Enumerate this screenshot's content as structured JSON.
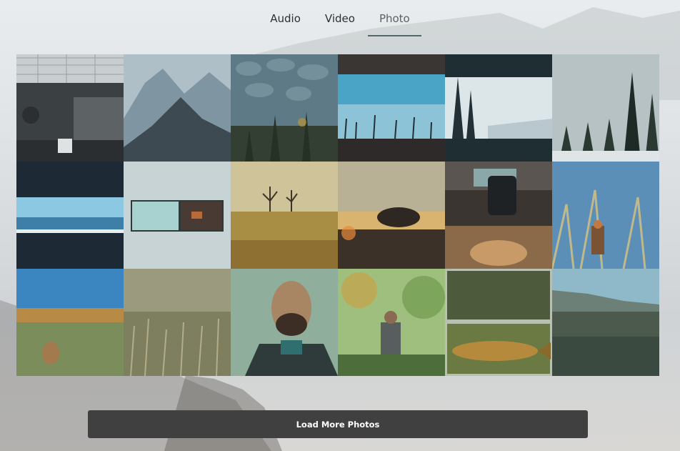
{
  "nav": {
    "tabs": [
      {
        "label": "Audio",
        "active": false
      },
      {
        "label": "Video",
        "active": false
      },
      {
        "label": "Photo",
        "active": true
      }
    ],
    "accent": "#4f6a6f"
  },
  "gallery": {
    "photos": [
      {
        "subject": "recording studio room"
      },
      {
        "subject": "misty mountain peaks"
      },
      {
        "subject": "stone wall with pine trees"
      },
      {
        "subject": "bare trees under blue sky"
      },
      {
        "subject": "snowy forest clearing"
      },
      {
        "subject": "snow-covered spruce forest"
      },
      {
        "subject": "lake horizon"
      },
      {
        "subject": "window view of forest"
      },
      {
        "subject": "golden autumn field"
      },
      {
        "subject": "tree at sunset"
      },
      {
        "subject": "studio desk with sleeping dog"
      },
      {
        "subject": "person in tall grass"
      },
      {
        "subject": "dog in meadow"
      },
      {
        "subject": "wild grass field"
      },
      {
        "subject": "bearded man selfie"
      },
      {
        "subject": "hiker in autumn foliage"
      },
      {
        "subject": "trout and stream"
      },
      {
        "subject": "misty valley"
      }
    ]
  },
  "load_more": {
    "label": "Load More Photos"
  }
}
